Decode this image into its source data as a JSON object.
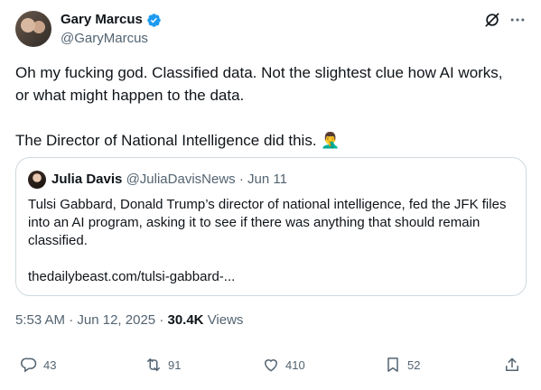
{
  "author": {
    "name": "Gary Marcus",
    "handle": "@GaryMarcus"
  },
  "tweet": {
    "line1": "Oh my fucking god. Classified data. Not the slightest clue how AI works,",
    "line2": "or what might happen to the data.",
    "line3": "The Director of National Intelligence did this. 🤦‍♂️"
  },
  "quote": {
    "name": "Julia Davis",
    "handle": "@JuliaDavisNews",
    "date": "Jun 11",
    "separator": "·",
    "text": "Tulsi Gabbard, Donald Trump’s director of national intelligence, fed the JFK files into an AI program, asking it to see if there was anything that should remain classified.",
    "link": "thedailybeast.com/tulsi-gabbard-..."
  },
  "meta": {
    "time": "5:53 AM",
    "date": "Jun 12, 2025",
    "views_count": "30.4K",
    "views_label": "Views",
    "sep": "·"
  },
  "actions": {
    "replies": "43",
    "reposts": "91",
    "likes": "410",
    "bookmarks": "52"
  },
  "colors": {
    "verified": "#1d9bf0",
    "secondary_text": "#536471",
    "border": "#cfd9de"
  }
}
